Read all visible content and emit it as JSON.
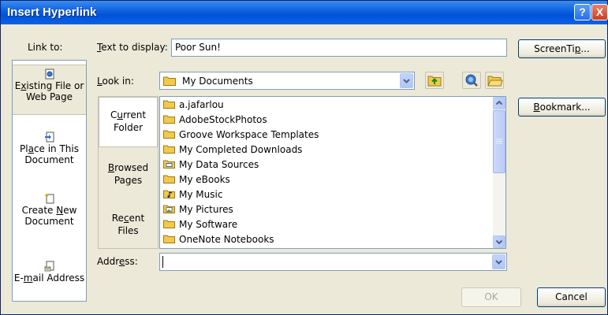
{
  "window": {
    "title": "Insert Hyperlink",
    "help_glyph": "?",
    "close_glyph": "X"
  },
  "link_to": {
    "label": "Link to:",
    "items": [
      {
        "line1_pre": "E",
        "line1_u": "x",
        "line1_post": "isting File or",
        "line2": "Web Page",
        "icon": "web-page-icon"
      },
      {
        "line1_pre": "Pl",
        "line1_u": "a",
        "line1_post": "ce in This",
        "line2": "Document",
        "icon": "document-place-icon"
      },
      {
        "line1_pre": "Create ",
        "line1_u": "N",
        "line1_post": "ew",
        "line2": "Document",
        "icon": "new-document-icon"
      },
      {
        "line1_pre": "E-",
        "line1_u": "m",
        "line1_post": "ail Address",
        "line2": "",
        "icon": "email-icon"
      }
    ]
  },
  "text_to_display": {
    "label_u": "T",
    "label_rest": "ext to display:",
    "value": "Poor Sun!"
  },
  "screentip_button": {
    "pre": "ScreenTi",
    "u": "p",
    "post": "..."
  },
  "look_in": {
    "label_u": "L",
    "label_rest": "ook in:",
    "value": "My Documents"
  },
  "inner_nav": [
    {
      "line1_pre": "C",
      "line1_u": "u",
      "line1_post": "rrent",
      "line2": "Folder"
    },
    {
      "line1_pre": "",
      "line1_u": "B",
      "line1_post": "rowsed",
      "line2": "Pages"
    },
    {
      "line1_pre": "Re",
      "line1_u": "c",
      "line1_post": "ent",
      "line2": "Files"
    }
  ],
  "files": [
    {
      "name": "a.jafarlou",
      "icon": "folder-icon"
    },
    {
      "name": "AdobeStockPhotos",
      "icon": "folder-icon"
    },
    {
      "name": "Groove Workspace Templates",
      "icon": "folder-icon"
    },
    {
      "name": "My Completed Downloads",
      "icon": "folder-icon"
    },
    {
      "name": "My Data Sources",
      "icon": "data-folder-icon"
    },
    {
      "name": "My eBooks",
      "icon": "folder-icon"
    },
    {
      "name": "My Music",
      "icon": "music-folder-icon"
    },
    {
      "name": "My Pictures",
      "icon": "pictures-folder-icon"
    },
    {
      "name": "My Software",
      "icon": "folder-icon"
    },
    {
      "name": "OneNote Notebooks",
      "icon": "folder-icon"
    }
  ],
  "bookmark_button": {
    "pre": "",
    "u": "B",
    "post": "ookmark..."
  },
  "address": {
    "label_pre": "Addr",
    "label_u": "e",
    "label_post": "ss:",
    "value": ""
  },
  "ok_button": {
    "label": "OK"
  },
  "cancel_button": {
    "label": "Cancel"
  },
  "colors": {
    "titlebar": "#0a5fe0",
    "dialog_bg": "#ece9d8",
    "folder": "#f2c94c",
    "field_border": "#7f9db9"
  }
}
